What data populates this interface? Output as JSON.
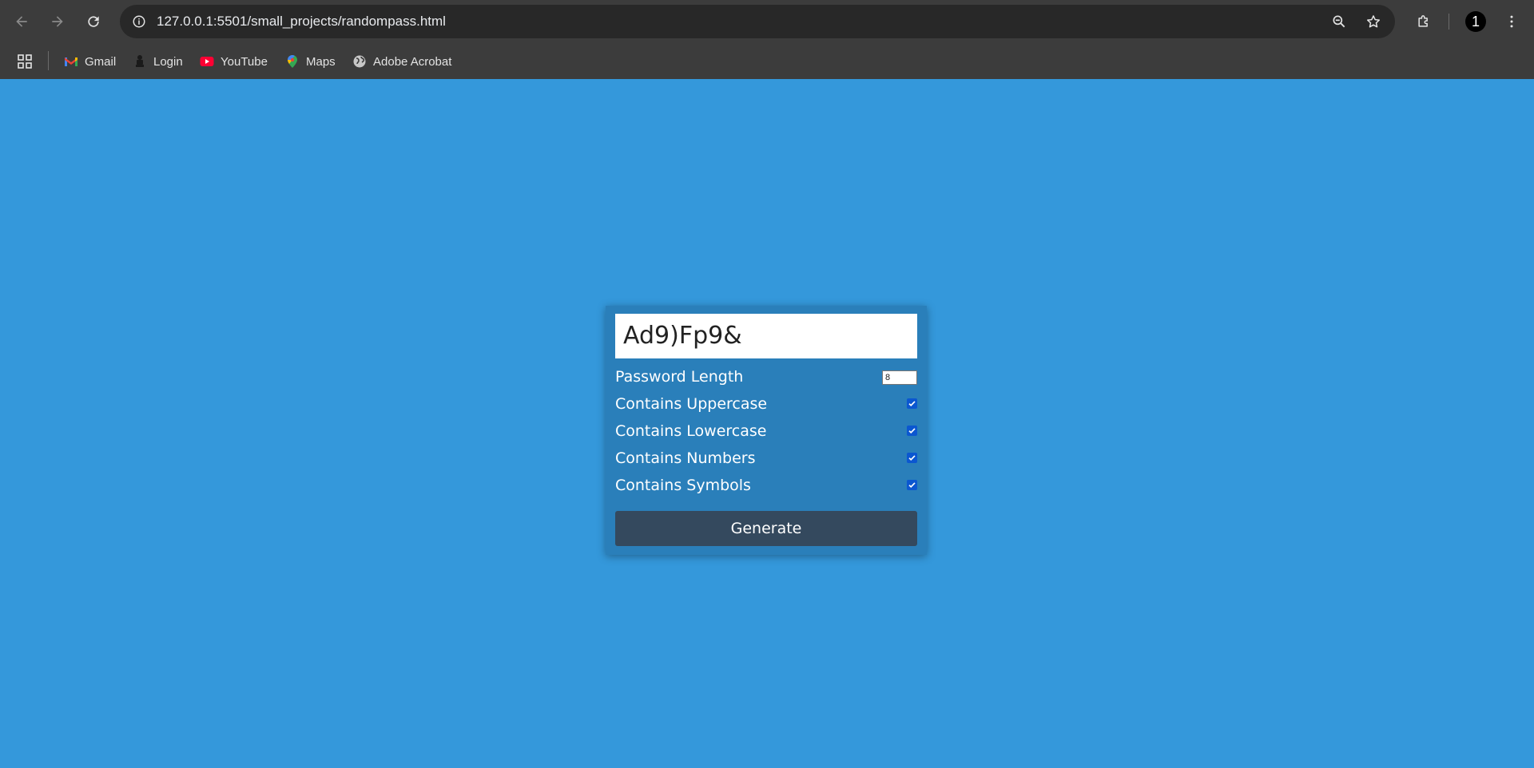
{
  "browser": {
    "url_host": "127.0.0.1:5501",
    "url_path": "/small_projects/randompass.html",
    "profile_number": "1",
    "icons": {
      "back": "arrow-back-icon",
      "forward": "arrow-forward-icon",
      "reload": "reload-icon",
      "site_info": "info-icon",
      "zoom": "zoom-out-icon",
      "bookmark_star": "star-icon",
      "extensions": "puzzle-icon",
      "menu": "kebab-menu-icon"
    }
  },
  "bookmarks": [
    {
      "label": "Gmail",
      "icon": "gmail-icon"
    },
    {
      "label": "Login",
      "icon": "emblem-icon"
    },
    {
      "label": "YouTube",
      "icon": "youtube-icon"
    },
    {
      "label": "Maps",
      "icon": "maps-pin-icon"
    },
    {
      "label": "Adobe Acrobat",
      "icon": "globe-icon"
    }
  ],
  "app": {
    "result": "Ad9)Fp9&",
    "length_label": "Password Length",
    "length_value": "8",
    "options": [
      {
        "label": "Contains Uppercase",
        "checked": true
      },
      {
        "label": "Contains Lowercase",
        "checked": true
      },
      {
        "label": "Contains Numbers",
        "checked": true
      },
      {
        "label": "Contains Symbols",
        "checked": true
      }
    ],
    "generate_label": "Generate"
  },
  "colors": {
    "page_background": "#3498db",
    "card_background": "#2a7fba",
    "button_background": "#34495e",
    "checkbox_accent": "#0b57d0",
    "chrome_background": "#3c3c3c"
  }
}
